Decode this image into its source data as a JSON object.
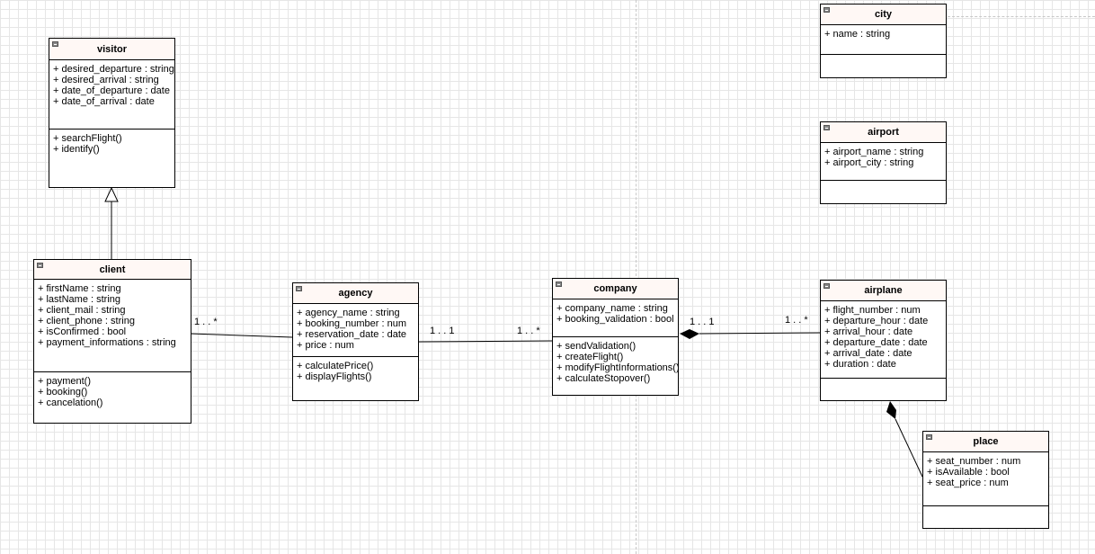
{
  "classes": {
    "visitor": {
      "name": "visitor",
      "attributes": [
        "+ desired_departure : string",
        "+ desired_arrival : string",
        "+ date_of_departure : date",
        "+ date_of_arrival : date"
      ],
      "methods": [
        "+ searchFlight()",
        "+ identify()"
      ]
    },
    "client": {
      "name": "client",
      "attributes": [
        "+ firstName : string",
        "+ lastName : string",
        "+ client_mail : string",
        "+ client_phone : string",
        "+ isConfirmed : bool",
        "+ payment_informations : string"
      ],
      "methods": [
        "+ payment()",
        "+ booking()",
        "+ cancelation()"
      ]
    },
    "agency": {
      "name": "agency",
      "attributes": [
        "+ agency_name : string",
        "+ booking_number : num",
        "+ reservation_date : date",
        "+ price : num"
      ],
      "methods": [
        "+ calculatePrice()",
        "+ displayFlights()"
      ]
    },
    "company": {
      "name": "company",
      "attributes": [
        "+ company_name : string",
        "+ booking_validation : bool"
      ],
      "methods": [
        "+ sendValidation()",
        "+ createFlight()",
        "+ modifyFlightInformations()",
        "+ calculateStopover()"
      ]
    },
    "airplane": {
      "name": "airplane",
      "attributes": [
        "+ flight_number : num",
        "+ departure_hour : date",
        "+ arrival_hour : date",
        "+ departure_date : date",
        "+ arrival_date : date",
        "+ duration : date"
      ],
      "methods": []
    },
    "city": {
      "name": "city",
      "attributes": [
        "+ name : string"
      ],
      "methods": []
    },
    "airport": {
      "name": "airport",
      "attributes": [
        "+ airport_name : string",
        "+ airport_city : string"
      ],
      "methods": []
    },
    "place": {
      "name": "place",
      "attributes": [
        "+ seat_number : num",
        "+ isAvailable : bool",
        "+ seat_price : num"
      ],
      "methods": []
    }
  },
  "relations": {
    "client_agency": {
      "type": "association",
      "client_multiplicity": "1 . . *"
    },
    "agency_company": {
      "type": "association",
      "agency_multiplicity": "1 . . 1",
      "company_multiplicity": "1 . . *"
    },
    "company_airplane": {
      "type": "composition",
      "company_multiplicity": "1 . . 1",
      "airplane_multiplicity": "1 . . *"
    },
    "visitor_client": {
      "type": "generalization"
    },
    "airplane_place": {
      "type": "composition"
    }
  }
}
